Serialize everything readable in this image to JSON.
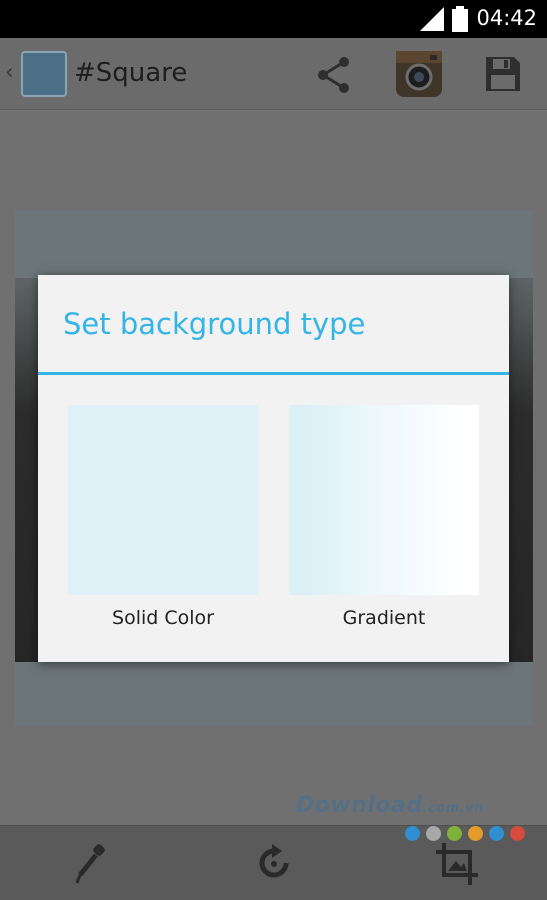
{
  "status_bar": {
    "time": "04:42"
  },
  "app_bar": {
    "title": "#Square"
  },
  "dialog": {
    "title": "Set background type",
    "options": [
      {
        "label": "Solid Color",
        "color": "#dff2f7"
      },
      {
        "label": "Gradient"
      }
    ]
  },
  "watermark": {
    "text": "Download",
    "suffix": ".com.vn"
  },
  "colors": {
    "accent": "#33b5e5",
    "dialog_bg": "#f2f2f2",
    "dots": [
      "#2f8fd0",
      "#a8a8a8",
      "#7fb13c",
      "#e29c2c",
      "#2f8fd0",
      "#d64b3c"
    ]
  },
  "icons": {
    "app_bar": [
      "back-icon",
      "app-icon",
      "share-icon",
      "instagram-icon",
      "save-icon"
    ],
    "bottom_bar": [
      "eyedropper-icon",
      "rotate-icon",
      "crop-icon"
    ]
  }
}
